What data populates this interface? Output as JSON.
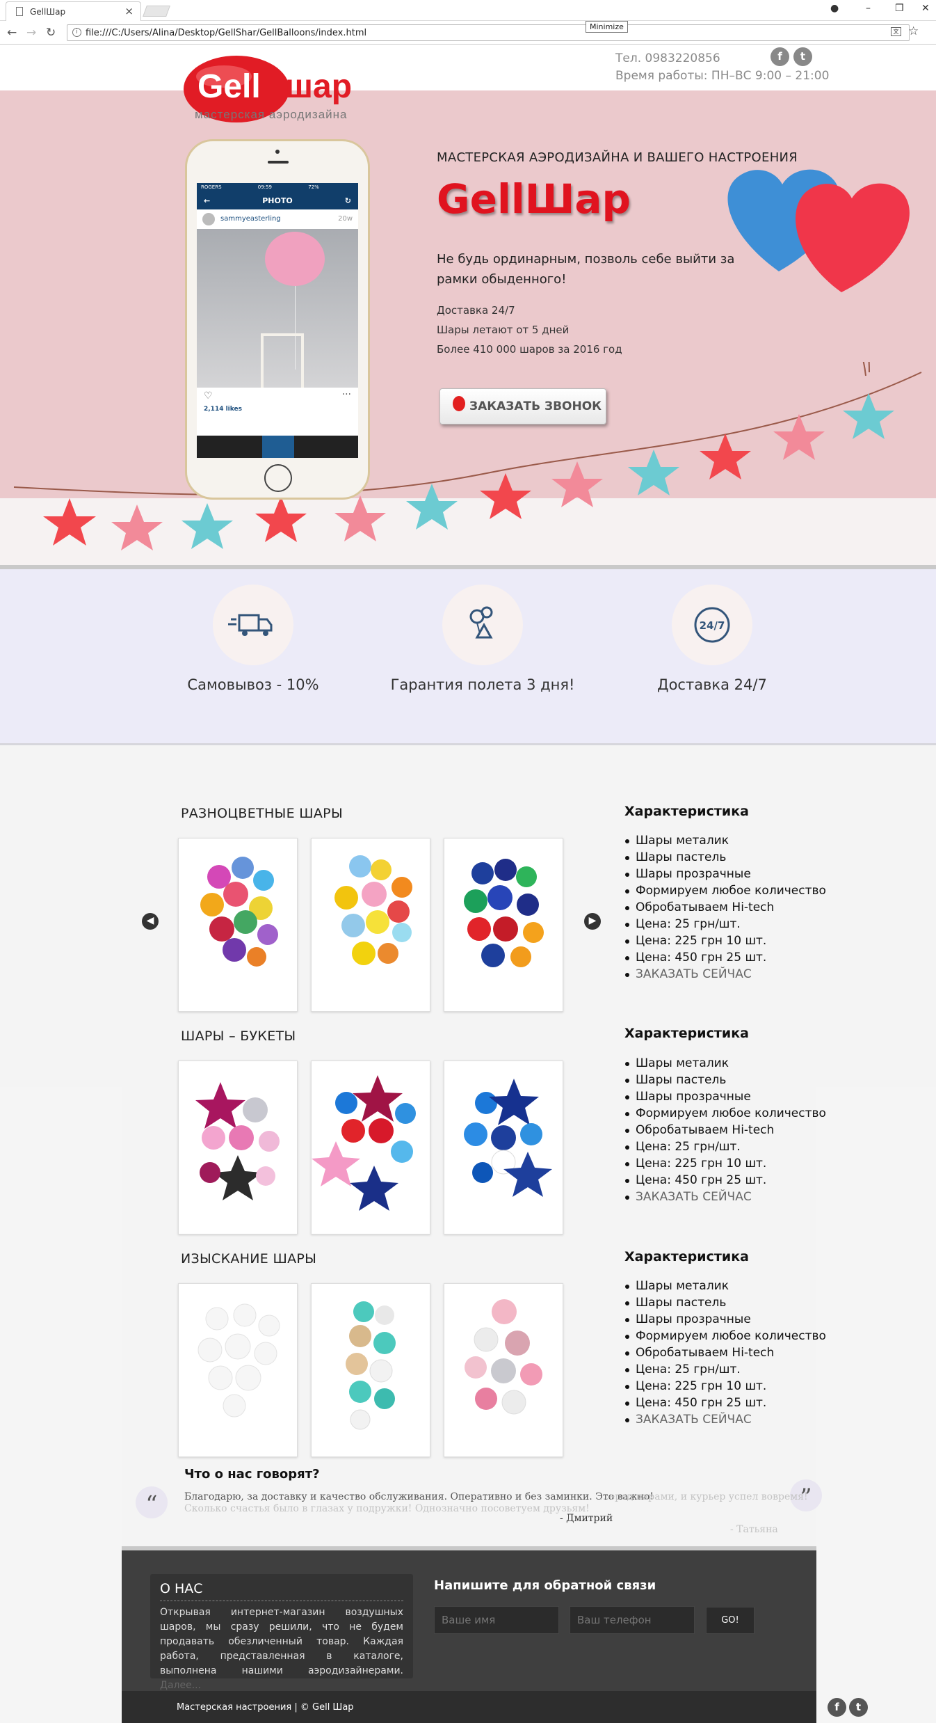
{
  "browser": {
    "tab_title": "GellШар",
    "url": "file:///C:/Users/Alina/Desktop/GellShar/GellBalloons/index.html",
    "tooltip": "Minimize"
  },
  "header": {
    "logo_word1": "Gell",
    "logo_word2": "шар",
    "logo_sub": "мастерская аэродизайна",
    "phone": "Тел. 0983220856",
    "hours": "Время работы: ПН–ВС 9:00 – 21:00"
  },
  "hero": {
    "kicker": "МАСТЕРСКАЯ АЭРОДИЗАЙНА И ВАШЕГО НАСТРОЕНИЯ",
    "title": "GellШар",
    "tagline": "Не будь ординарным, позволь себе выйти за рамки обыденного!",
    "facts": [
      "Доставка 24/7",
      "Шары летают от 5 дней",
      "Более 410 000 шаров за 2016 год"
    ],
    "cta": "ЗАКАЗАТЬ ЗВОНОК",
    "phone_app": {
      "carrier": "ROGERS",
      "time": "09:59",
      "battery": "72%",
      "screen_title": "PHOTO",
      "username": "sammyeasterling",
      "age": "20w",
      "likes": "2,114 likes"
    }
  },
  "features": [
    {
      "label": "Самовывоз - 10%",
      "icon": "truck-icon"
    },
    {
      "label": "Гарантия полета 3 дня!",
      "icon": "balloons-icon"
    },
    {
      "label": "Доставка 24/7",
      "icon": "clock-24-icon",
      "icon_text": "24/7"
    }
  ],
  "catalog": [
    {
      "title": "РАЗНОЦВЕТНЫЕ ШАРЫ",
      "spec_title": "Характеристика",
      "specs": [
        "Шары металик",
        "Шары пастель",
        "Шары прозрачные",
        "Формируем любое количество",
        "Обробатываем Hi-tech",
        "Цена: 25 грн/шт.",
        "Цена: 225 грн 10 шт.",
        "Цена: 450 грн 25 шт."
      ],
      "order_link": "ЗАКАЗАТЬ СЕЙЧАС"
    },
    {
      "title": "ШАРЫ – БУКЕТЫ",
      "spec_title": "Характеристика",
      "specs": [
        "Шары металик",
        "Шары пастель",
        "Шары прозрачные",
        "Формируем любое количество",
        "Обробатываем Hi-tech",
        "Цена: 25 грн/шт.",
        "Цена: 225 грн 10 шт.",
        "Цена: 450 грн 25 шт."
      ],
      "order_link": "ЗАКАЗАТЬ СЕЙЧАС"
    },
    {
      "title": "ИЗЫСКАНИЕ ШАРЫ",
      "spec_title": "Характеристика",
      "specs": [
        "Шары металик",
        "Шары пастель",
        "Шары прозрачные",
        "Формируем любое количество",
        "Обробатываем Hi-tech",
        "Цена: 25 грн/шт.",
        "Цена: 225 грн 10 шт.",
        "Цена: 450 грн 25 шт."
      ],
      "order_link": "ЗАКАЗАТЬ СЕЙЧАС"
    }
  ],
  "reviews": {
    "title": "Что о нас говорят?",
    "items": [
      {
        "text": "Благодарю, за доставку и качество обслуживания. Оперативно и без заминки. Это важно!",
        "author": "- Дмитрий"
      },
      {
        "text_line1": "…еред парами, и курьер успел вовремя!",
        "text_line2": "Сколько счастья было в глазах у подружки! Однозначно посоветуем друзьям!",
        "author": "- Татьяна"
      }
    ]
  },
  "footer": {
    "about_title": "О НАС",
    "about_text": "Открывая интернет-магазин воздушных шаров, мы сразу решили, что не будем продавать обезличенный товар. Каждая работа, представленная в каталоге, выполнена нашими аэродизайнерами.",
    "about_more": "Далее...",
    "feedback_title": "Напишите для обратной связи",
    "name_placeholder": "Ваше имя",
    "phone_placeholder": "Ваш телефон",
    "send": "GO!",
    "copyright": "Мастерская настроения | © Gell Шар"
  },
  "colors": {
    "hero_bg": "#ebc9cc",
    "features_bg": "#ecebf8",
    "brand_red": "#e0131f",
    "footer_bg": "#3f3f3f"
  }
}
